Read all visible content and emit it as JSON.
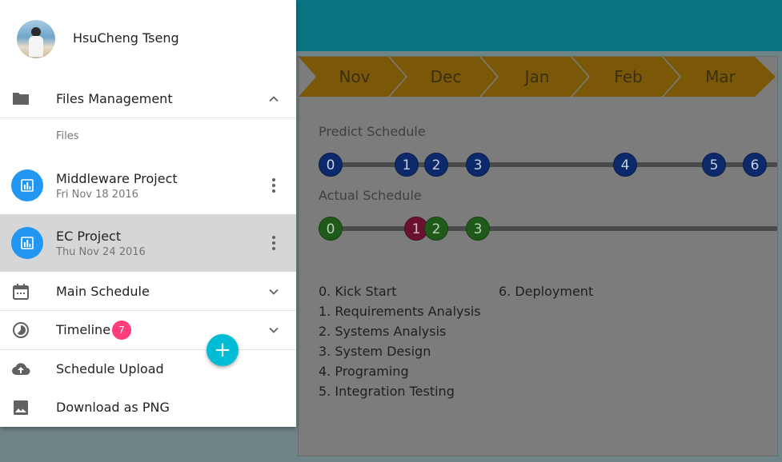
{
  "user": {
    "name": "HsuCheng Tseng"
  },
  "drawer": {
    "files_management": "Files Management",
    "files_sublabel": "Files",
    "projects": [
      {
        "name": "Middleware Project",
        "date": "Fri Nov 18 2016"
      },
      {
        "name": "EC Project",
        "date": "Thu Nov 24 2016"
      }
    ],
    "main_schedule": "Main Schedule",
    "timeline": "Timeline",
    "timeline_badge": "7",
    "schedule_upload": "Schedule Upload",
    "download_png": "Download as PNG",
    "fab_symbol": "+"
  },
  "schedule": {
    "months": [
      "Nov",
      "Dec",
      "Jan",
      "Feb",
      "Mar"
    ],
    "predict_label": "Predict Schedule",
    "actual_label": "Actual Schedule",
    "predict_markers": [
      "0",
      "1",
      "2",
      "3",
      "4",
      "5",
      "6"
    ],
    "actual_markers": [
      "0",
      "1",
      "2",
      "3"
    ],
    "legend_col1": [
      "0. Kick Start",
      "1. Requirements Analysis",
      "2. Systems Analysis",
      "3. System Design",
      "4. Programing",
      "5. Integration Testing"
    ],
    "legend_col2": [
      "6. Deployment"
    ]
  },
  "colors": {
    "topbar": "#0a7483",
    "month_arrow": "#7a5808",
    "fab": "#00bcd4",
    "badge": "#ff3d7a",
    "project_icon": "#2196f3",
    "selected_row": "#d6d6d6"
  },
  "icons": {
    "folder": "folder-icon",
    "chevron_up": "chevron-up-icon",
    "chevron_down": "chevron-down-icon",
    "chart": "bar-chart-icon",
    "more": "more-vert-icon",
    "calendar": "calendar-icon",
    "timelapse": "timelapse-icon",
    "cloud_upload": "cloud-upload-icon",
    "image": "image-icon",
    "add": "add-icon"
  }
}
